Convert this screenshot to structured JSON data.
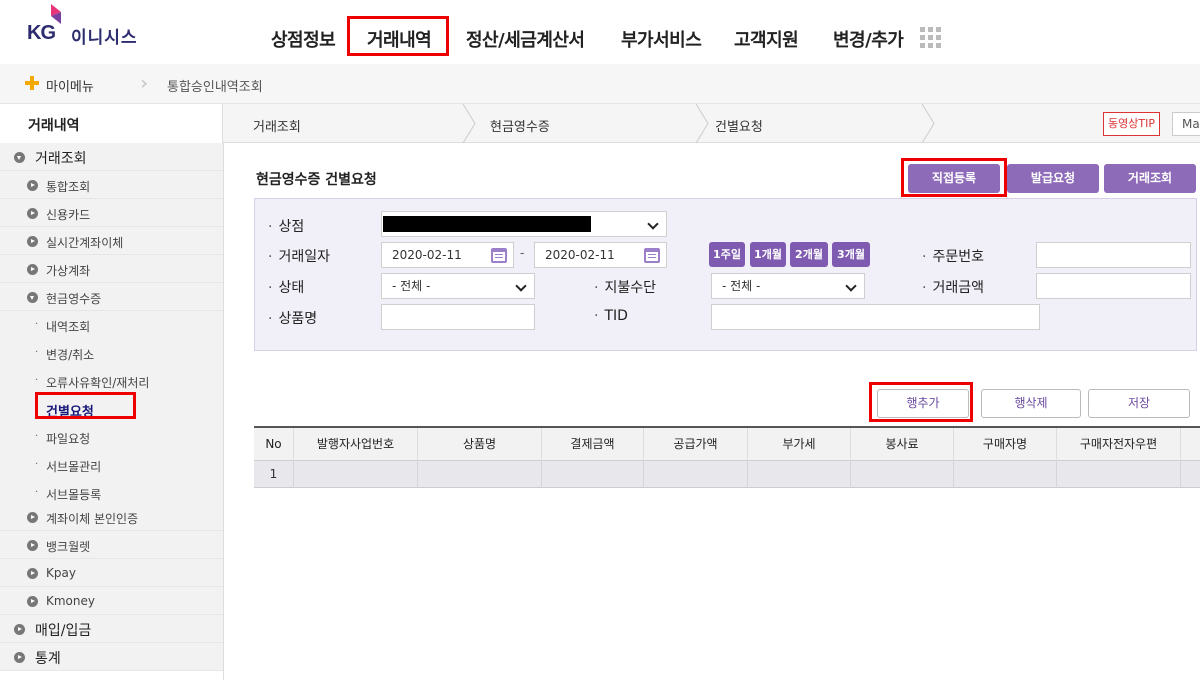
{
  "brand": {
    "kg": "KG",
    "name": "이니시스",
    "accent": "#8e6bb8",
    "highlight": "#ee0000"
  },
  "gnb": [
    "상점정보",
    "거래내역",
    "정산/세금계산서",
    "부가서비스",
    "고객지원",
    "변경/추가"
  ],
  "gnb_active_index": 1,
  "mymenu": {
    "label": "마이메뉴",
    "breadcrumb": "통합승인내역조회"
  },
  "tabs": {
    "section": "거래내역",
    "items": [
      "거래조회",
      "현금영수증",
      "건별요청"
    ],
    "video_tip": "동영상TIP",
    "more": "Ma"
  },
  "sidebar": {
    "items": [
      {
        "label": "거래조회",
        "level": "main",
        "open": true
      },
      {
        "label": "통합조회",
        "level": "sub"
      },
      {
        "label": "신용카드",
        "level": "sub"
      },
      {
        "label": "실시간계좌이체",
        "level": "sub"
      },
      {
        "label": "가상계좌",
        "level": "sub"
      },
      {
        "label": "현금영수증",
        "level": "sub",
        "open": true
      },
      {
        "label": "내역조회",
        "level": "leaf"
      },
      {
        "label": "변경/취소",
        "level": "leaf"
      },
      {
        "label": "오류사유확인/재처리",
        "level": "leaf"
      },
      {
        "label": "건별요청",
        "level": "leaf",
        "active": true
      },
      {
        "label": "파일요청",
        "level": "leaf"
      },
      {
        "label": "서브몰관리",
        "level": "leaf"
      },
      {
        "label": "서브몰등록",
        "level": "leaf"
      },
      {
        "label": "계좌이체 본인인증",
        "level": "sub"
      },
      {
        "label": "뱅크월렛",
        "level": "sub"
      },
      {
        "label": "Kpay",
        "level": "sub"
      },
      {
        "label": "Kmoney",
        "level": "sub"
      },
      {
        "label": "매입/입금",
        "level": "main"
      },
      {
        "label": "통계",
        "level": "main"
      }
    ]
  },
  "page": {
    "title": "현금영수증 건별요청",
    "buttons": {
      "direct": "직접등록",
      "issue": "발급요청",
      "search": "거래조회"
    }
  },
  "search": {
    "store_label": "상점",
    "date_label": "거래일자",
    "date_from": "2020-02-11",
    "date_sep": "-",
    "date_to": "2020-02-11",
    "periods": [
      "1주일",
      "1개월",
      "2개월",
      "3개월"
    ],
    "order_label": "주문번호",
    "status_label": "상태",
    "status_value": "- 전체 -",
    "payment_label": "지불수단",
    "payment_value": "- 전체 -",
    "amount_label": "거래금액",
    "product_label": "상품명",
    "tid_label": "TID"
  },
  "rows_actions": {
    "add": "행추가",
    "delete": "행삭제",
    "save": "저장"
  },
  "table": {
    "headers": [
      "No",
      "발행자사업번호",
      "상품명",
      "결제금액",
      "공급가액",
      "부가세",
      "봉사료",
      "구매자명",
      "구매자전자우편"
    ],
    "rows": [
      {
        "no": "1"
      }
    ]
  }
}
